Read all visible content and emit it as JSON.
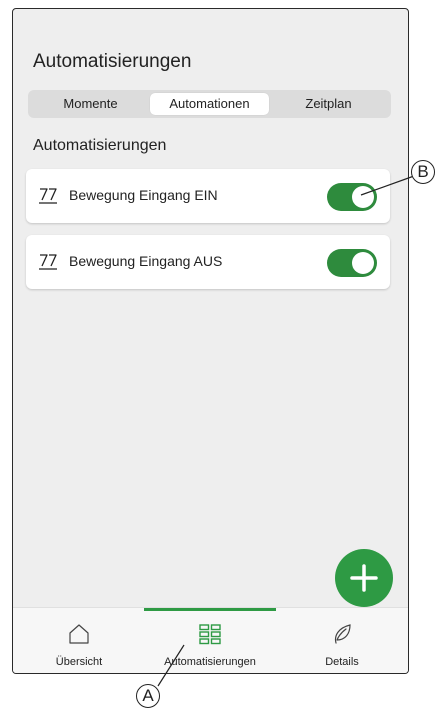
{
  "header": {
    "title": "Automatisierungen"
  },
  "segmented": {
    "tabs": [
      "Momente",
      "Automationen",
      "Zeitplan"
    ],
    "active": "Automationen"
  },
  "section": {
    "heading": "Automatisierungen"
  },
  "automations": [
    {
      "label": "Bewegung Eingang EIN",
      "enabled": true,
      "icon": "motion-sensor-icon"
    },
    {
      "label": "Bewegung Eingang AUS",
      "enabled": true,
      "icon": "motion-sensor-icon"
    }
  ],
  "fab": {
    "icon": "plus-icon"
  },
  "bottom_nav": {
    "items": [
      {
        "label": "Übersicht",
        "icon": "home-icon"
      },
      {
        "label": "Automatisierungen",
        "icon": "grid-icon"
      },
      {
        "label": "Details",
        "icon": "leaf-icon"
      }
    ],
    "active": "Automatisierungen"
  },
  "callouts": {
    "a": "A",
    "b": "B"
  },
  "colors": {
    "accent": "#2e9a44",
    "toggle": "#2e8b3d",
    "background": "#eeeeee"
  }
}
